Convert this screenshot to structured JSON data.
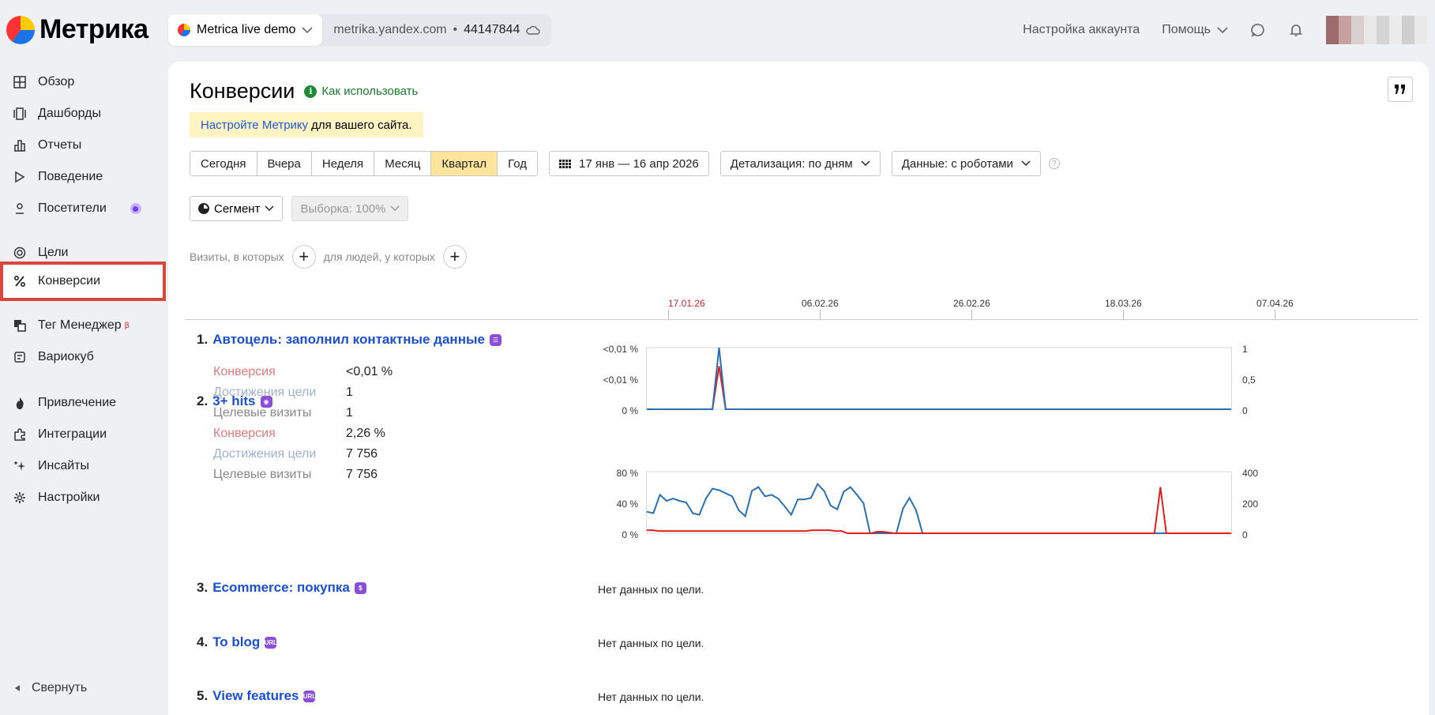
{
  "app": {
    "logo_text": "Метрика"
  },
  "counter": {
    "name": "Metrica live demo",
    "domain": "metrika.yandex.com",
    "separator": "•",
    "id": "44147844"
  },
  "header": {
    "account": "Настройка аккаунта",
    "help": "Помощь"
  },
  "sidebar": {
    "items": [
      {
        "label": "Обзор",
        "icon": "grid-icon"
      },
      {
        "label": "Дашборды",
        "icon": "dashboards-icon"
      },
      {
        "label": "Отчеты",
        "icon": "reports-icon"
      },
      {
        "label": "Поведение",
        "icon": "play-icon"
      },
      {
        "label": "Посетители",
        "icon": "person-icon"
      },
      {
        "label": "Цели",
        "icon": "target-icon"
      },
      {
        "label": "Конверсии",
        "icon": "percent-icon"
      },
      {
        "label": "Тег Менеджер",
        "icon": "tag-manager-icon",
        "sup": "β"
      },
      {
        "label": "Вариокуб",
        "icon": "variocube-icon"
      },
      {
        "label": "Привлечение",
        "icon": "fire-icon"
      },
      {
        "label": "Интеграции",
        "icon": "puzzle-icon"
      },
      {
        "label": "Инсайты",
        "icon": "sparkle-icon"
      },
      {
        "label": "Настройки",
        "icon": "gear-icon"
      }
    ],
    "collapse": "Свернуть"
  },
  "page": {
    "title": "Конверсии",
    "howto": "Как использовать",
    "notice_link": "Настройте Метрику",
    "notice_text": "для вашего сайта."
  },
  "periods": [
    "Сегодня",
    "Вчера",
    "Неделя",
    "Месяц",
    "Квартал",
    "Год"
  ],
  "active_period": "Квартал",
  "date_range": "17 янв — 16 апр 2026",
  "detail": "Детализация: по дням",
  "data_mode": "Данные: с роботами",
  "segment": "Сегмент",
  "sample": "Выборка: 100%",
  "filters": {
    "visits": "Визиты, в которых",
    "people": "для людей, у которых"
  },
  "timeline": [
    "17.01.26",
    "06.02.26",
    "26.02.26",
    "18.03.26",
    "07.04.26"
  ],
  "metric_names": {
    "conv": "Конверсия",
    "ach": "Достижения цели",
    "vis": "Целевые визиты"
  },
  "no_data": "Нет данных по цели.",
  "goals": [
    {
      "num": "1.",
      "title": "Автоцель: заполнил контактные данные",
      "conv": "<0,01 %",
      "ach": "1",
      "vis": "1",
      "axis_left": [
        "<0,01 %",
        "<0,01 %",
        "0 %"
      ],
      "axis_right": [
        "1",
        "0,5",
        "0"
      ]
    },
    {
      "num": "2.",
      "title": "3+ hits",
      "conv": "2,26 %",
      "ach": "7 756",
      "vis": "7 756",
      "axis_left": [
        "80 %",
        "40 %",
        "0 %"
      ],
      "axis_right": [
        "400",
        "200",
        "0"
      ]
    },
    {
      "num": "3.",
      "title": "Ecommerce: покупка"
    },
    {
      "num": "4.",
      "title": "To blog"
    },
    {
      "num": "5.",
      "title": "View features"
    }
  ],
  "chart_data": [
    {
      "type": "line",
      "series": [
        {
          "name": "",
          "color": "#e02020",
          "values": [
            0,
            0,
            0,
            0,
            0,
            0,
            0,
            0,
            0,
            0,
            0,
            0.7,
            0,
            0,
            0,
            0,
            0,
            0,
            0,
            0,
            0,
            0,
            0,
            0,
            0,
            0,
            0,
            0,
            0,
            0,
            0,
            0,
            0,
            0,
            0,
            0,
            0,
            0,
            0,
            0,
            0,
            0,
            0,
            0,
            0,
            0,
            0,
            0,
            0,
            0,
            0,
            0,
            0,
            0,
            0,
            0,
            0,
            0,
            0,
            0,
            0,
            0,
            0,
            0,
            0,
            0,
            0,
            0,
            0,
            0,
            0,
            0,
            0,
            0,
            0,
            0,
            0,
            0,
            0,
            0,
            0,
            0,
            0,
            0,
            0,
            0,
            0,
            0,
            0,
            0
          ]
        },
        {
          "name": "",
          "color": "#2a70b0",
          "values": [
            0,
            0,
            0,
            0,
            0,
            0,
            0,
            0,
            0,
            0,
            0,
            1,
            0,
            0,
            0,
            0,
            0,
            0,
            0,
            0,
            0,
            0,
            0,
            0,
            0,
            0,
            0,
            0,
            0,
            0,
            0,
            0,
            0,
            0,
            0,
            0,
            0,
            0,
            0,
            0,
            0,
            0,
            0,
            0,
            0,
            0,
            0,
            0,
            0,
            0,
            0,
            0,
            0,
            0,
            0,
            0,
            0,
            0,
            0,
            0,
            0,
            0,
            0,
            0,
            0,
            0,
            0,
            0,
            0,
            0,
            0,
            0,
            0,
            0,
            0,
            0,
            0,
            0,
            0,
            0,
            0,
            0,
            0,
            0,
            0,
            0,
            0,
            0,
            0,
            0
          ]
        }
      ],
      "ylim": [
        0,
        1
      ]
    },
    {
      "type": "line",
      "series": [
        {
          "name": "",
          "color": "#2a70b0",
          "values": [
            28,
            26,
            50,
            42,
            45,
            42,
            40,
            26,
            24,
            45,
            58,
            56,
            52,
            48,
            30,
            22,
            55,
            60,
            48,
            50,
            45,
            35,
            24,
            44,
            44,
            46,
            64,
            55,
            36,
            31,
            54,
            60,
            50,
            39,
            0,
            0,
            0,
            0,
            0,
            32,
            46,
            30,
            0,
            0,
            0,
            0,
            0,
            0,
            0,
            0,
            0,
            0,
            0,
            0,
            0,
            0,
            0,
            0,
            0,
            0,
            0,
            0,
            0,
            0,
            0,
            0,
            0,
            0,
            0,
            0,
            0,
            0,
            0,
            0,
            0,
            0,
            0,
            0,
            0,
            0,
            0,
            0,
            0,
            0,
            0,
            0,
            0,
            0,
            0,
            0
          ]
        },
        {
          "name": "",
          "color": "#e02020",
          "values": [
            4,
            4,
            3,
            3,
            3,
            3,
            3,
            3,
            3,
            3,
            3,
            3,
            3,
            3,
            3,
            3,
            3,
            3,
            3,
            3,
            3,
            3,
            3,
            3,
            3,
            3,
            3,
            3,
            4,
            4,
            4,
            4,
            3,
            3,
            0,
            0,
            0,
            0,
            0,
            2,
            2,
            1,
            0,
            0,
            0,
            0,
            0,
            0,
            0,
            0,
            0,
            0,
            0,
            0,
            0,
            0,
            0,
            0,
            0,
            0,
            0,
            0,
            0,
            0,
            0,
            0,
            0,
            0,
            0,
            0,
            0,
            0,
            0,
            0,
            0,
            0,
            0,
            0,
            0,
            0,
            0,
            0,
            0,
            0,
            0,
            0,
            0,
            60,
            0,
            0,
            0,
            0,
            0,
            0,
            0,
            0,
            0,
            0,
            0,
            0
          ]
        }
      ],
      "ylim": [
        0,
        80
      ]
    }
  ]
}
